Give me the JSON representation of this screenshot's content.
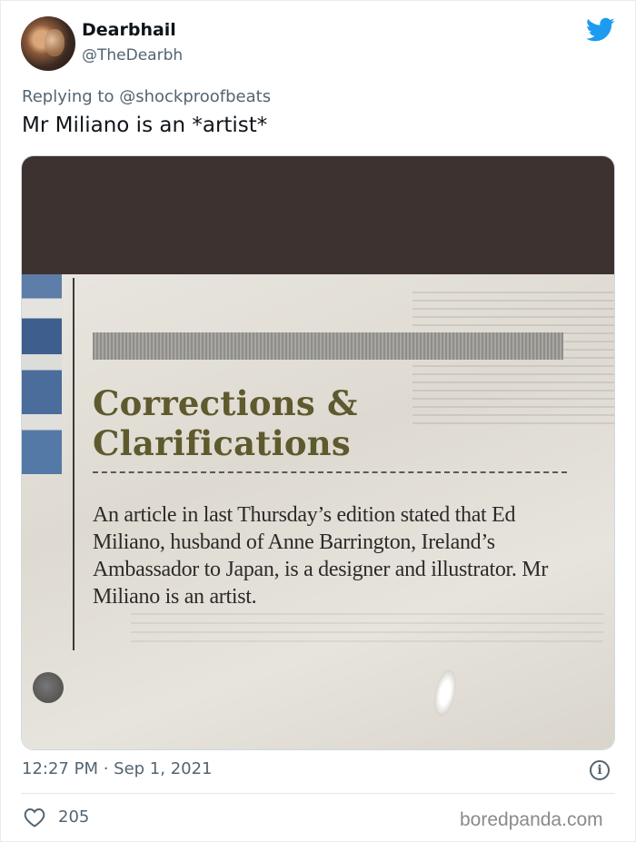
{
  "author": {
    "display_name": "Dearbhail",
    "handle": "@TheDearbh"
  },
  "reply": {
    "prefix": "Replying to",
    "mention": "@shockproofbeats"
  },
  "tweet": {
    "text": "Mr Miliano is an *artist*",
    "timestamp": "12:27 PM · Sep 1, 2021",
    "likes": "205"
  },
  "newspaper_clipping": {
    "headline_line1": "Corrections &",
    "headline_line2": "Clarifications",
    "body": "An article in last Thursday’s edition stated that Ed Miliano, husband of Anne Barrington, Ireland’s Ambassador to Japan, is a designer and illustrator. Mr Miliano is an artist."
  },
  "icons": {
    "brand": "twitter-bird-icon",
    "info": "info-icon",
    "like": "heart-icon"
  },
  "colors": {
    "twitter_blue": "#1d9bf0",
    "secondary_text": "#536471",
    "headline_olive": "#5f5a2e"
  },
  "watermark": "boredpanda.com"
}
